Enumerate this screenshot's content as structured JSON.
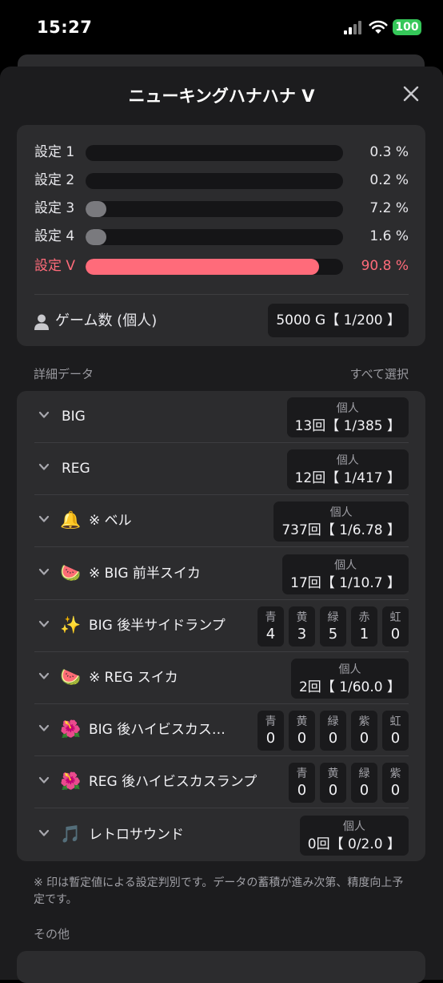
{
  "status": {
    "time": "15:27",
    "battery": "100"
  },
  "header": {
    "title": "ニューキングハナハナ V"
  },
  "settings": [
    {
      "label": "設定 1",
      "pct": "0.3 %",
      "value": 0.3,
      "highlight": false
    },
    {
      "label": "設定 2",
      "pct": "0.2 %",
      "value": 0.2,
      "highlight": false
    },
    {
      "label": "設定 3",
      "pct": "7.2 %",
      "value": 7.2,
      "highlight": false
    },
    {
      "label": "設定 4",
      "pct": "1.6 %",
      "value": 1.6,
      "highlight": false
    },
    {
      "label": "設定 V",
      "pct": "90.8 %",
      "value": 90.8,
      "highlight": true
    }
  ],
  "games": {
    "label": "ゲーム数 (個人)",
    "value": "5000 G【 1/200 】"
  },
  "details_header": {
    "title": "詳細データ",
    "select_all": "すべて選択"
  },
  "details": [
    {
      "label": "BIG",
      "type": "value",
      "key": "個人",
      "value": "13回【 1/385 】"
    },
    {
      "label": "REG",
      "type": "value",
      "key": "個人",
      "value": "12回【 1/417 】"
    },
    {
      "label": "※ ベル",
      "emoji": "🔔",
      "icon_name": "bell-icon",
      "type": "value",
      "key": "個人",
      "value": "737回【 1/6.78 】"
    },
    {
      "label": "※ BIG 前半スイカ",
      "emoji": "🍉",
      "icon_name": "watermelon-icon",
      "type": "value",
      "key": "個人",
      "value": "17回【 1/10.7 】"
    },
    {
      "label": "BIG 後半サイドランプ",
      "emoji": "✨",
      "icon_name": "sparkles-icon",
      "type": "counts",
      "counts": [
        {
          "k": "青",
          "v": "4"
        },
        {
          "k": "黄",
          "v": "3"
        },
        {
          "k": "緑",
          "v": "5"
        },
        {
          "k": "赤",
          "v": "1"
        },
        {
          "k": "虹",
          "v": "0"
        }
      ]
    },
    {
      "label": "※ REG スイカ",
      "emoji": "🍉",
      "icon_name": "watermelon-icon",
      "type": "value",
      "key": "個人",
      "value": "2回【 1/60.0 】"
    },
    {
      "label": "BIG 後ハイビスカスラ…",
      "emoji": "🌺",
      "icon_name": "hibiscus-icon",
      "type": "counts",
      "counts": [
        {
          "k": "青",
          "v": "0"
        },
        {
          "k": "黄",
          "v": "0"
        },
        {
          "k": "緑",
          "v": "0"
        },
        {
          "k": "紫",
          "v": "0"
        },
        {
          "k": "虹",
          "v": "0"
        }
      ]
    },
    {
      "label": "REG 後ハイビスカスランプ",
      "emoji": "🌺",
      "icon_name": "hibiscus-icon",
      "type": "counts",
      "counts": [
        {
          "k": "青",
          "v": "0"
        },
        {
          "k": "黄",
          "v": "0"
        },
        {
          "k": "緑",
          "v": "0"
        },
        {
          "k": "紫",
          "v": "0"
        }
      ]
    },
    {
      "label": "レトロサウンド",
      "emoji": "🎵",
      "icon_name": "music-note-icon",
      "type": "value",
      "key": "個人",
      "value": "0回【 0/2.0 】"
    }
  ],
  "note": "※ 印は暫定値による設定判別です。データの蓄積が進み次第、精度向上予定です。",
  "other_header": "その他",
  "colors": {
    "accent": "#ff6b7a",
    "bar_default": "#7a7a7e",
    "card": "#2c2c2e",
    "sheet": "#1c1c1e"
  }
}
